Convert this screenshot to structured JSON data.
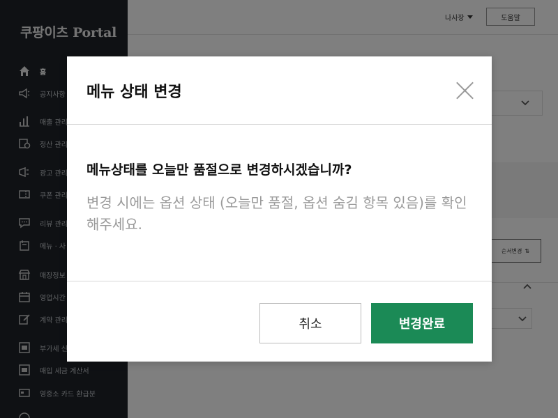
{
  "app": {
    "brand_prefix": "쿠팡이츠",
    "brand_suffix": "Portal"
  },
  "sidebar": {
    "items": [
      {
        "label": "홈",
        "icon": "home-icon",
        "active": true
      },
      {
        "label": "공지사항",
        "icon": "megaphone-icon"
      },
      {
        "label": "매출 관리",
        "icon": "bar-chart-icon"
      },
      {
        "label": "정산 관리",
        "icon": "settlement-icon"
      },
      {
        "label": "광고 관리",
        "icon": "ad-icon"
      },
      {
        "label": "쿠폰 관리",
        "icon": "coupon-icon"
      },
      {
        "label": "리뷰 관리",
        "icon": "review-icon"
      },
      {
        "label": "메뉴 · 사",
        "icon": "menu-icon"
      },
      {
        "label": "매장정보",
        "icon": "store-icon"
      },
      {
        "label": "영업시간",
        "icon": "calendar-icon"
      },
      {
        "label": "계약 관리",
        "icon": "contract-icon"
      },
      {
        "label": "부가세 신",
        "icon": "vat-icon"
      },
      {
        "label": "매입 세금 계산서",
        "icon": "tax-invoice-icon"
      },
      {
        "label": "영중소 카드 환급분",
        "icon": "card-icon"
      }
    ]
  },
  "topbar": {
    "user_label": "나사장",
    "help_label": "도움말"
  },
  "background": {
    "order_change_label": "순서변경",
    "order_change_icon": "sort-arrows-icon"
  },
  "modal": {
    "title": "메뉴 상태 변경",
    "question": "메뉴상태를 오늘만 품절으로 변경하시겠습니까?",
    "description": "변경 시에는 옵션 상태 (오늘만 품절, 옵션 숨김 항목 있음)를 확인해주세요.",
    "cancel_label": "취소",
    "confirm_label": "변경완료"
  },
  "colors": {
    "sidebar_bg": "#1e2329",
    "confirm_button": "#1b8a56",
    "overlay": "rgba(0,0,0,0.5)"
  }
}
